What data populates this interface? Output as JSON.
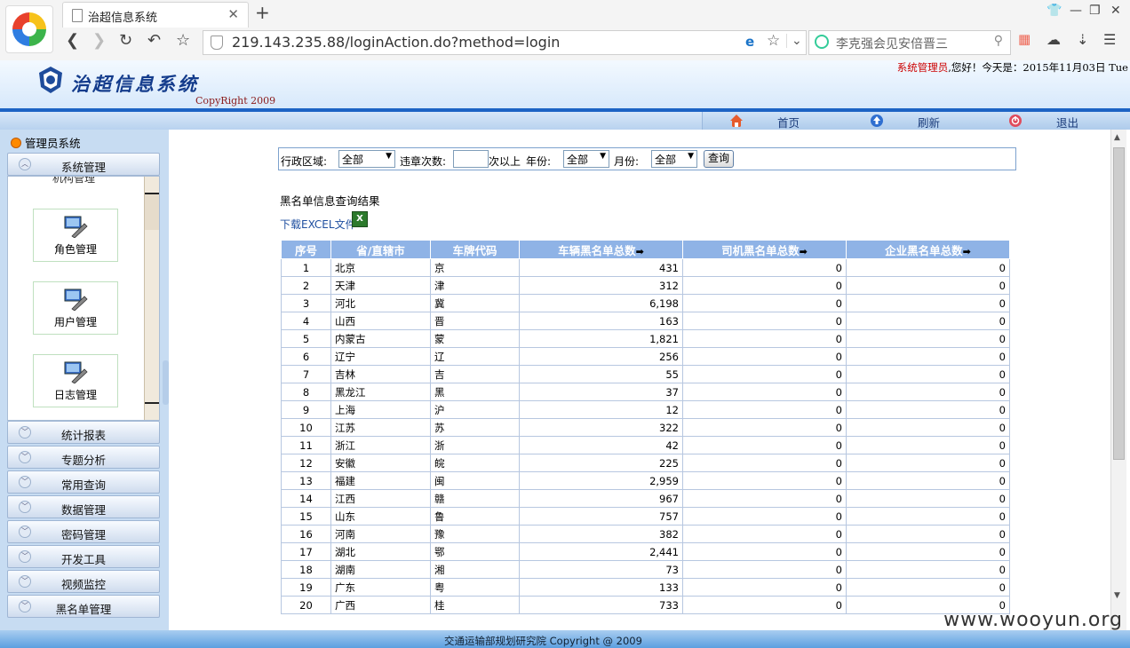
{
  "browser": {
    "tab_title": "治超信息系统",
    "url": "219.143.235.88/loginAction.do?method=login",
    "search_placeholder": "李克强会见安倍晋三"
  },
  "header": {
    "app_name": "治超信息系统",
    "copyright": "CopyRight 2009",
    "greeting_role": "系统管理员",
    "greeting_text": ",您好！今天是：2015年11月03日 Tue"
  },
  "top_menu": {
    "home": "首页",
    "refresh": "刷新",
    "logout": "退出"
  },
  "sidebar": {
    "title": "管理员系统",
    "expanded": "系统管理",
    "cut_item": "机构管理",
    "sub_items": [
      "角色管理",
      "用户管理",
      "日志管理"
    ],
    "categories": [
      "统计报表",
      "专题分析",
      "常用查询",
      "数据管理",
      "密码管理",
      "开发工具",
      "视频监控",
      "黑名单管理"
    ]
  },
  "filter": {
    "region_label": "行政区域:",
    "region_value": "全部",
    "violations_label": "违章次数:",
    "violations_suffix": "次以上",
    "year_label": "年份:",
    "year_value": "全部",
    "month_label": "月份:",
    "month_value": "全部",
    "query_button": "查询"
  },
  "result_title": "黑名单信息查询结果",
  "download_link": "下载EXCEL文件",
  "table": {
    "headers": [
      "序号",
      "省/直辖市",
      "车牌代码",
      "车辆黑名单总数",
      "司机黑名单总数",
      "企业黑名单总数"
    ],
    "rows": [
      [
        "1",
        "北京",
        "京",
        "431",
        "0",
        "0"
      ],
      [
        "2",
        "天津",
        "津",
        "312",
        "0",
        "0"
      ],
      [
        "3",
        "河北",
        "冀",
        "6,198",
        "0",
        "0"
      ],
      [
        "4",
        "山西",
        "晋",
        "163",
        "0",
        "0"
      ],
      [
        "5",
        "内蒙古",
        "蒙",
        "1,821",
        "0",
        "0"
      ],
      [
        "6",
        "辽宁",
        "辽",
        "256",
        "0",
        "0"
      ],
      [
        "7",
        "吉林",
        "吉",
        "55",
        "0",
        "0"
      ],
      [
        "8",
        "黑龙江",
        "黑",
        "37",
        "0",
        "0"
      ],
      [
        "9",
        "上海",
        "沪",
        "12",
        "0",
        "0"
      ],
      [
        "10",
        "江苏",
        "苏",
        "322",
        "0",
        "0"
      ],
      [
        "11",
        "浙江",
        "浙",
        "42",
        "0",
        "0"
      ],
      [
        "12",
        "安徽",
        "皖",
        "225",
        "0",
        "0"
      ],
      [
        "13",
        "福建",
        "闽",
        "2,959",
        "0",
        "0"
      ],
      [
        "14",
        "江西",
        "赣",
        "967",
        "0",
        "0"
      ],
      [
        "15",
        "山东",
        "鲁",
        "757",
        "0",
        "0"
      ],
      [
        "16",
        "河南",
        "豫",
        "382",
        "0",
        "0"
      ],
      [
        "17",
        "湖北",
        "鄂",
        "2,441",
        "0",
        "0"
      ],
      [
        "18",
        "湖南",
        "湘",
        "73",
        "0",
        "0"
      ],
      [
        "19",
        "广东",
        "粤",
        "133",
        "0",
        "0"
      ],
      [
        "20",
        "广西",
        "桂",
        "733",
        "0",
        "0"
      ]
    ]
  },
  "footer": "交通运输部规划研究院 Copyright @ 2009",
  "watermark": "www.wooyun.org",
  "colors": {
    "header_blue": "#1d63c4",
    "table_header": "#8fb3e6",
    "sidebar_bg": "#c7dcf2",
    "greeting_role": "#cc0000"
  },
  "icons": [
    "browser-logo-icon",
    "page-icon",
    "back-icon",
    "forward-icon",
    "reload-icon",
    "undo-icon",
    "bookmark-star-icon",
    "shield-icon",
    "home-icon",
    "refresh-icon",
    "logout-icon",
    "excel-icon",
    "sort-arrow-icon"
  ]
}
